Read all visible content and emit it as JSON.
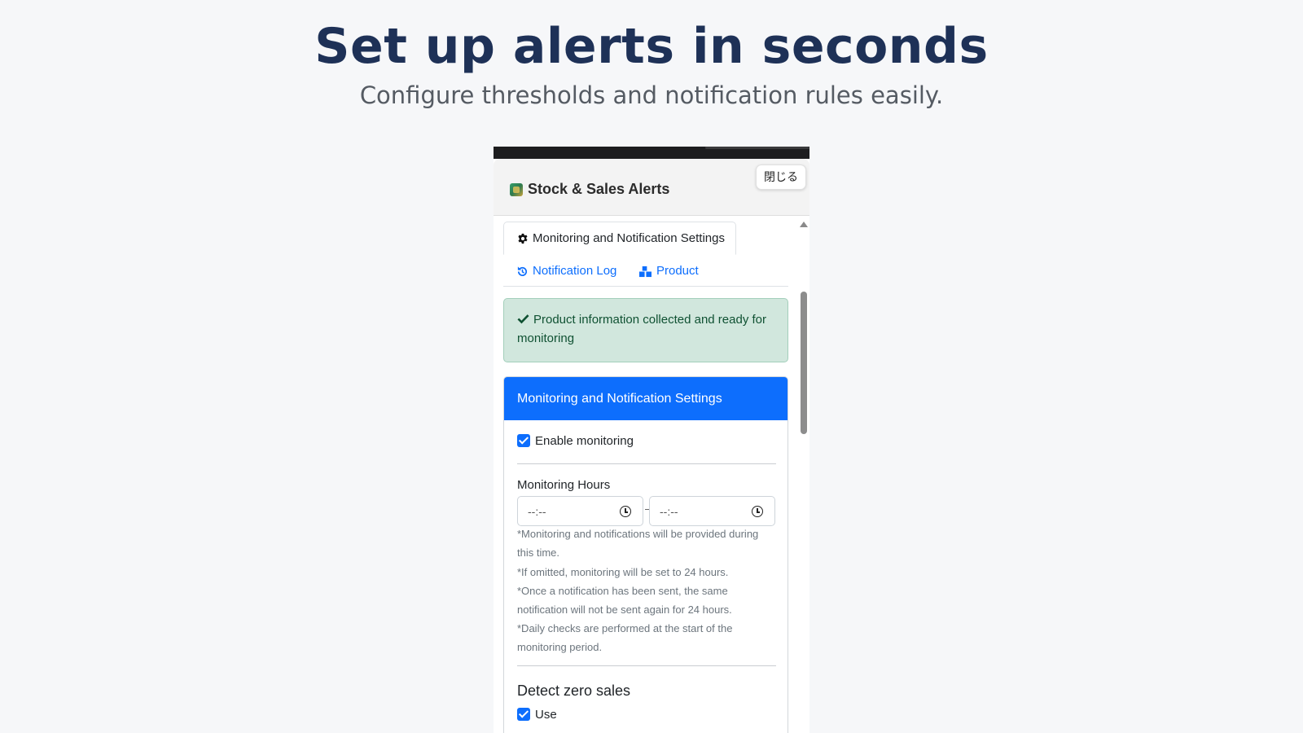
{
  "hero": {
    "title": "Set up alerts in seconds",
    "subtitle": "Configure thresholds and notification rules easily."
  },
  "window": {
    "app_title": "Stock & Sales Alerts",
    "app_icon": "app-icon",
    "close_label": "閉じる"
  },
  "tabs": {
    "active": {
      "label": "Monitoring and Notification Settings",
      "icon": "gear-icon"
    },
    "items": [
      {
        "label": "Notification Log",
        "icon": "history-icon"
      },
      {
        "label": "Product",
        "icon": "product-icon"
      }
    ]
  },
  "alert": {
    "text": "Product information collected and ready for monitoring",
    "icon": "check-icon"
  },
  "settings_card": {
    "header": "Monitoring and Notification Settings",
    "enable_monitoring": {
      "label": "Enable monitoring",
      "checked": true
    },
    "hours": {
      "label": "Monitoring Hours",
      "start_value": "--:--",
      "end_value": "--:--",
      "separator": "-"
    },
    "notes": [
      "*Monitoring and notifications will be provided during this time.",
      "*If omitted, monitoring will be set to 24 hours.",
      "*Once a notification has been sent, the same notification will not be sent again for 24 hours.",
      "*Daily checks are performed at the start of the monitoring period."
    ],
    "zero_sales": {
      "title": "Detect zero sales",
      "use": {
        "label": "Use",
        "checked": true
      }
    }
  },
  "colors": {
    "primary": "#0d6efd",
    "success_bg": "#d1e7dd",
    "success_text": "#0f5132",
    "hero_title": "#1e3157"
  }
}
